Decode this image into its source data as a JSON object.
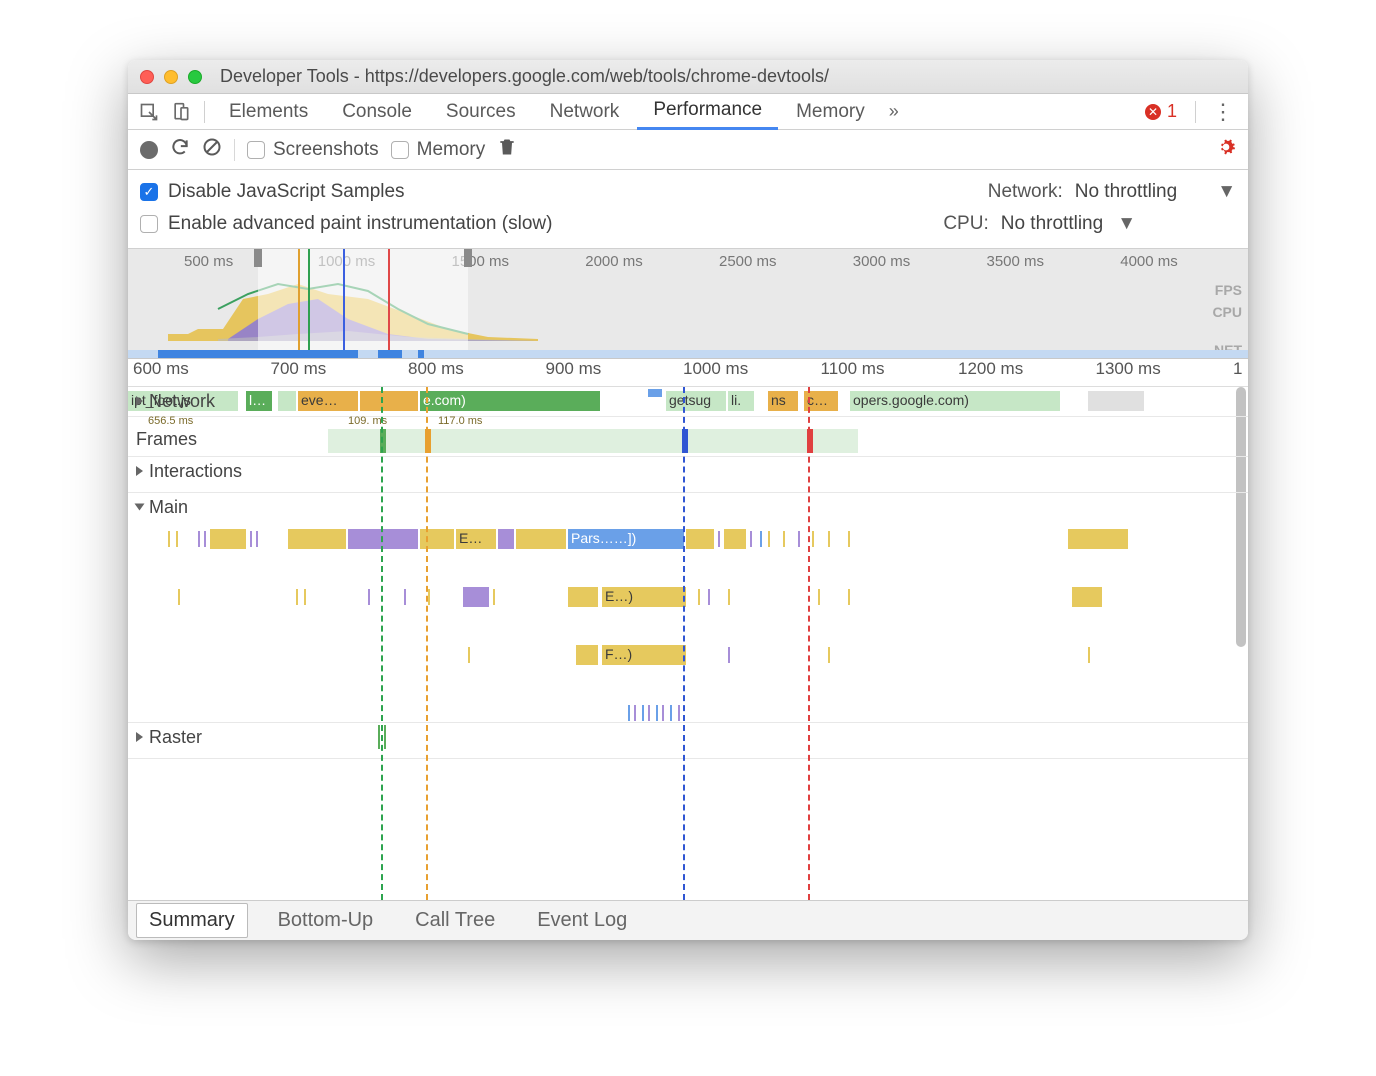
{
  "window": {
    "title": "Developer Tools - https://developers.google.com/web/tools/chrome-devtools/"
  },
  "tabs": {
    "items": [
      "Elements",
      "Console",
      "Sources",
      "Network",
      "Performance",
      "Memory"
    ],
    "active": "Performance",
    "error_count": "1"
  },
  "toolbar": {
    "screenshots": "Screenshots",
    "memory": "Memory"
  },
  "settings": {
    "disable_js": "Disable JavaScript Samples",
    "enable_paint": "Enable advanced paint instrumentation (slow)",
    "network_label": "Network:",
    "network_value": "No throttling",
    "cpu_label": "CPU:",
    "cpu_value": "No throttling"
  },
  "overview": {
    "ticks": [
      "500 ms",
      "1000 ms",
      "1500 ms",
      "2000 ms",
      "2500 ms",
      "3000 ms",
      "3500 ms",
      "4000 ms"
    ],
    "lanes": {
      "fps": "FPS",
      "cpu": "CPU",
      "net": "NET"
    }
  },
  "ruler": {
    "ticks": [
      "600 ms",
      "700 ms",
      "800 ms",
      "900 ms",
      "1000 ms",
      "1100 ms",
      "1200 ms",
      "1300 ms",
      "1"
    ]
  },
  "tracks": {
    "network": "Network",
    "frames": "Frames",
    "interactions": "Interactions",
    "main": "Main",
    "raster": "Raster",
    "frame_labels": {
      "a": "656.5 ms",
      "b": "109. ms",
      "c": "117.0 ms"
    },
    "net_items": {
      "a": "ipt_foot.js",
      "b": "l…",
      "c": "eve…",
      "d": "e.com)",
      "e": "getsug",
      "f": "li.",
      "g": "ns",
      "h": "c…",
      "i": "opers.google.com)"
    },
    "main_items": {
      "e": "E…",
      "p": "Pars……])",
      "e2": "E…)",
      "f": "F…)"
    }
  },
  "bottom_tabs": {
    "items": [
      "Summary",
      "Bottom-Up",
      "Call Tree",
      "Event Log"
    ],
    "active": "Summary"
  }
}
